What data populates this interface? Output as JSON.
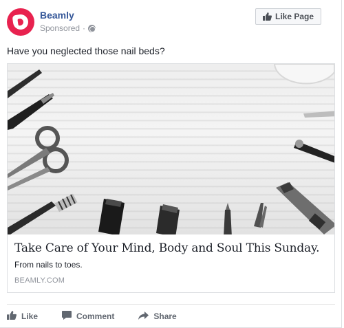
{
  "post": {
    "page_name": "Beamly",
    "sponsored_label": "Sponsored",
    "separator": "·",
    "like_page_label": "Like Page",
    "text": "Have you neglected those nail beds?"
  },
  "link_preview": {
    "headline": "Take Care of Your Mind, Body and Soul This Sunday.",
    "description": "From nails to toes.",
    "domain": "BEAMLY.COM"
  },
  "actions": {
    "like": "Like",
    "comment": "Comment",
    "share": "Share"
  },
  "colors": {
    "brand": "#e8224f",
    "link": "#365899",
    "muted": "#90949c",
    "action": "#616770"
  },
  "icons": [
    "avatar-logo",
    "globe-icon",
    "thumbs-up-icon",
    "comment-icon",
    "share-icon"
  ]
}
